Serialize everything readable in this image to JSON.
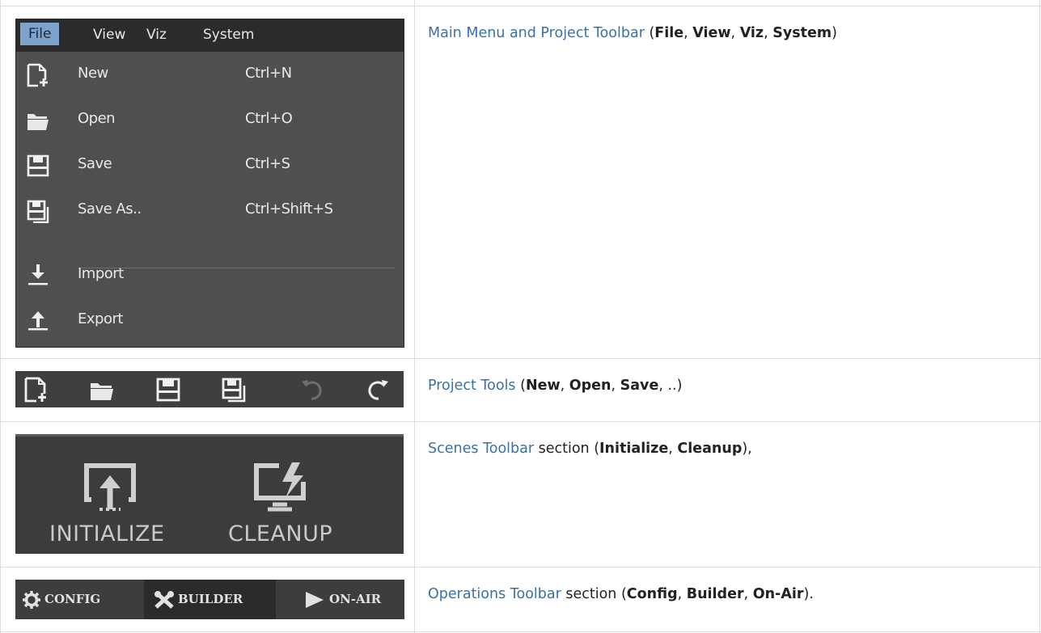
{
  "menu": {
    "bar": [
      "File",
      "View",
      "Viz",
      "System"
    ],
    "items": [
      {
        "label": "New",
        "shortcut": "Ctrl+N",
        "icon": "new-file-icon"
      },
      {
        "label": "Open",
        "shortcut": "Ctrl+O",
        "icon": "folder-open-icon"
      },
      {
        "label": "Save",
        "shortcut": "Ctrl+S",
        "icon": "save-icon"
      },
      {
        "label": "Save As..",
        "shortcut": "Ctrl+Shift+S",
        "icon": "save-as-icon"
      },
      {
        "label": "Import",
        "shortcut": "",
        "icon": "import-icon"
      },
      {
        "label": "Export",
        "shortcut": "",
        "icon": "export-icon"
      }
    ]
  },
  "project_tools_icons": [
    "new-file-icon",
    "folder-open-icon",
    "save-icon",
    "save-as-icon",
    "undo-icon",
    "redo-icon"
  ],
  "scenes_toolbar": {
    "initialize": "INITIALIZE",
    "cleanup": "CLEANUP"
  },
  "operations_toolbar": {
    "config": "CONFIG",
    "builder": "BUILDER",
    "onair": "ON-AIR"
  },
  "rows": [
    {
      "link": "Main Menu and Project Toolbar",
      "pre": " (",
      "items": [
        "File",
        "View",
        "Viz",
        "System"
      ],
      "post": ")"
    },
    {
      "link": "Project Tools",
      "pre": " (",
      "items": [
        "New",
        "Open",
        "Save"
      ],
      "post": ", ..)"
    },
    {
      "link": "Scenes Toolbar",
      "pre": " section (",
      "items": [
        "Initialize",
        "Cleanup"
      ],
      "post": "),"
    },
    {
      "link": "Operations Toolbar",
      "pre": " section (",
      "items": [
        "Config",
        "Builder",
        "On-Air"
      ],
      "post": ")."
    }
  ],
  "colors": {
    "link": "#3a72a8",
    "menu_bg": "#4e4f51",
    "menu_highlight": "#7da2cc"
  }
}
